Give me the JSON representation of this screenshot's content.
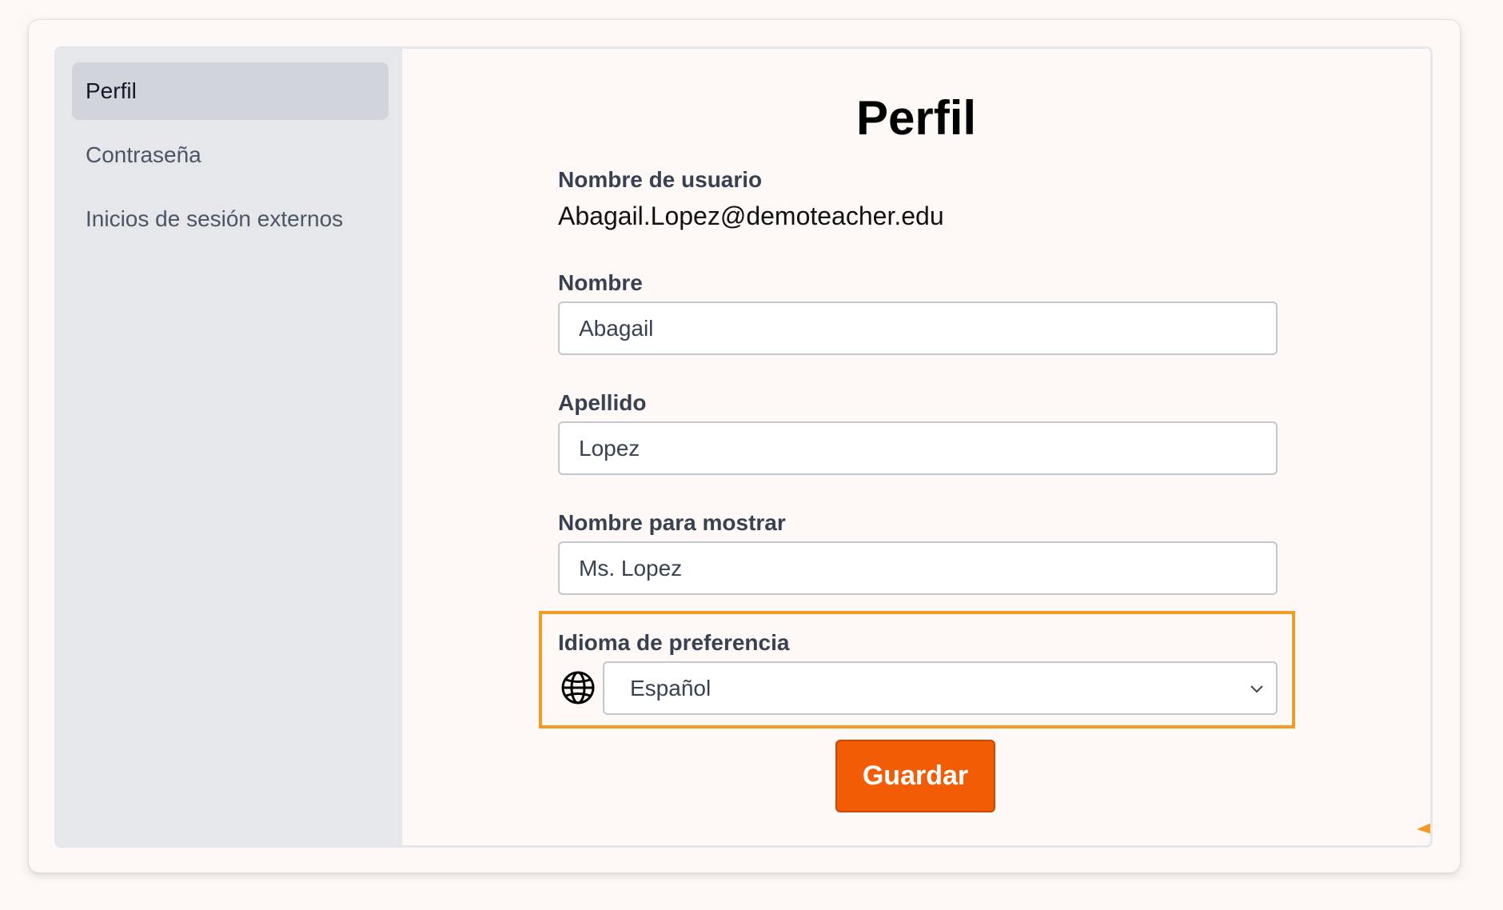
{
  "sidebar": {
    "items": [
      {
        "label": "Perfil",
        "active": true
      },
      {
        "label": "Contraseña",
        "active": false
      },
      {
        "label": "Inicios de sesión externos",
        "active": false
      }
    ]
  },
  "main": {
    "title": "Perfil",
    "username": {
      "label": "Nombre de usuario",
      "value": "Abagail.Lopez@demoteacher.edu"
    },
    "first_name": {
      "label": "Nombre",
      "value": "Abagail"
    },
    "last_name": {
      "label": "Apellido",
      "value": "Lopez"
    },
    "display_name": {
      "label": "Nombre para mostrar",
      "value": "Ms. Lopez"
    },
    "language": {
      "label": "Idioma de preferencia",
      "selected": "Español",
      "icon": "globe-icon"
    },
    "save_label": "Guardar"
  },
  "colors": {
    "accent": "#f25c05",
    "highlight": "#f39a24",
    "sidebar_bg": "#e5e7eb",
    "sidebar_active": "#d1d5db"
  }
}
